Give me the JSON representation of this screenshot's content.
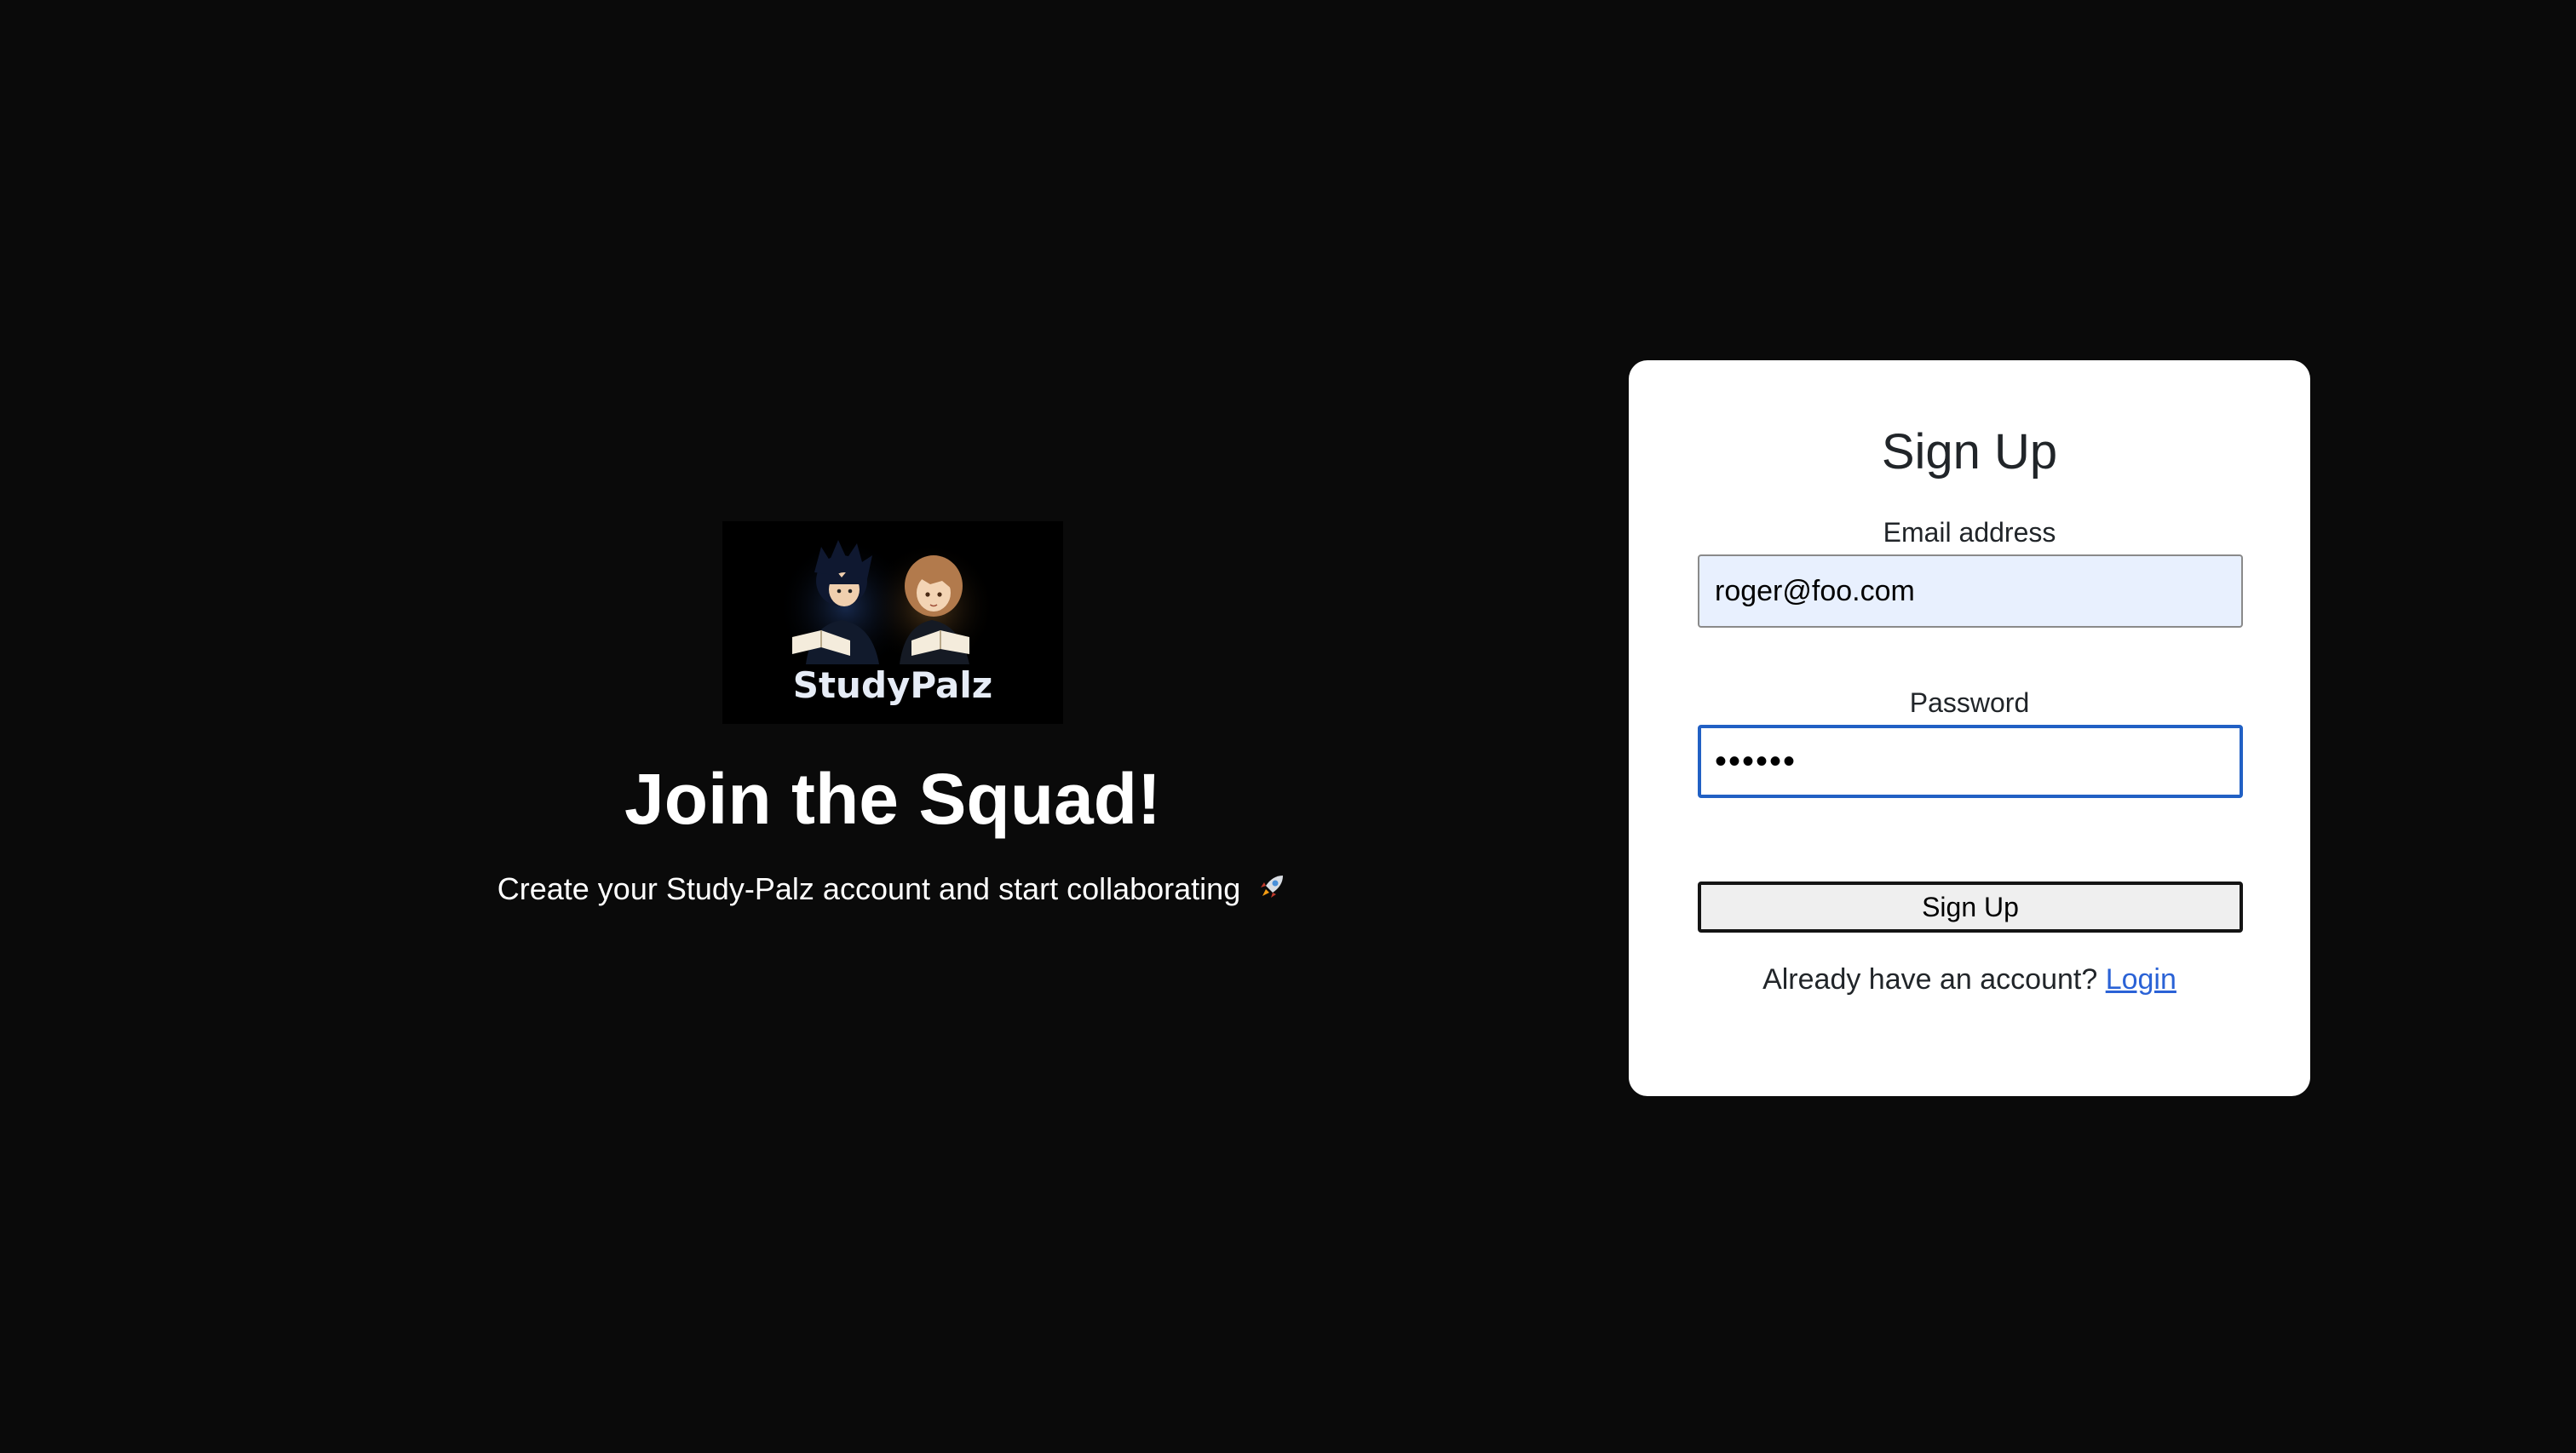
{
  "hero": {
    "logo_text": "StudyPalz",
    "title": "Join the Squad!",
    "subtitle": "Create your Study-Palz account and start collaborating",
    "subtitle_icon": "rocket-icon"
  },
  "signup_form": {
    "title": "Sign Up",
    "email": {
      "label": "Email address",
      "value": "roger@foo.com"
    },
    "password": {
      "label": "Password",
      "value": "••••••",
      "focused": true
    },
    "submit_label": "Sign Up",
    "login_prompt": "Already have an account?",
    "login_link": "Login"
  },
  "colors": {
    "page_background": "#0a0a0a",
    "card_background": "#ffffff",
    "email_autofill_background": "#e8f0fe",
    "focus_border": "#2160c4",
    "link": "#2a62d6"
  }
}
